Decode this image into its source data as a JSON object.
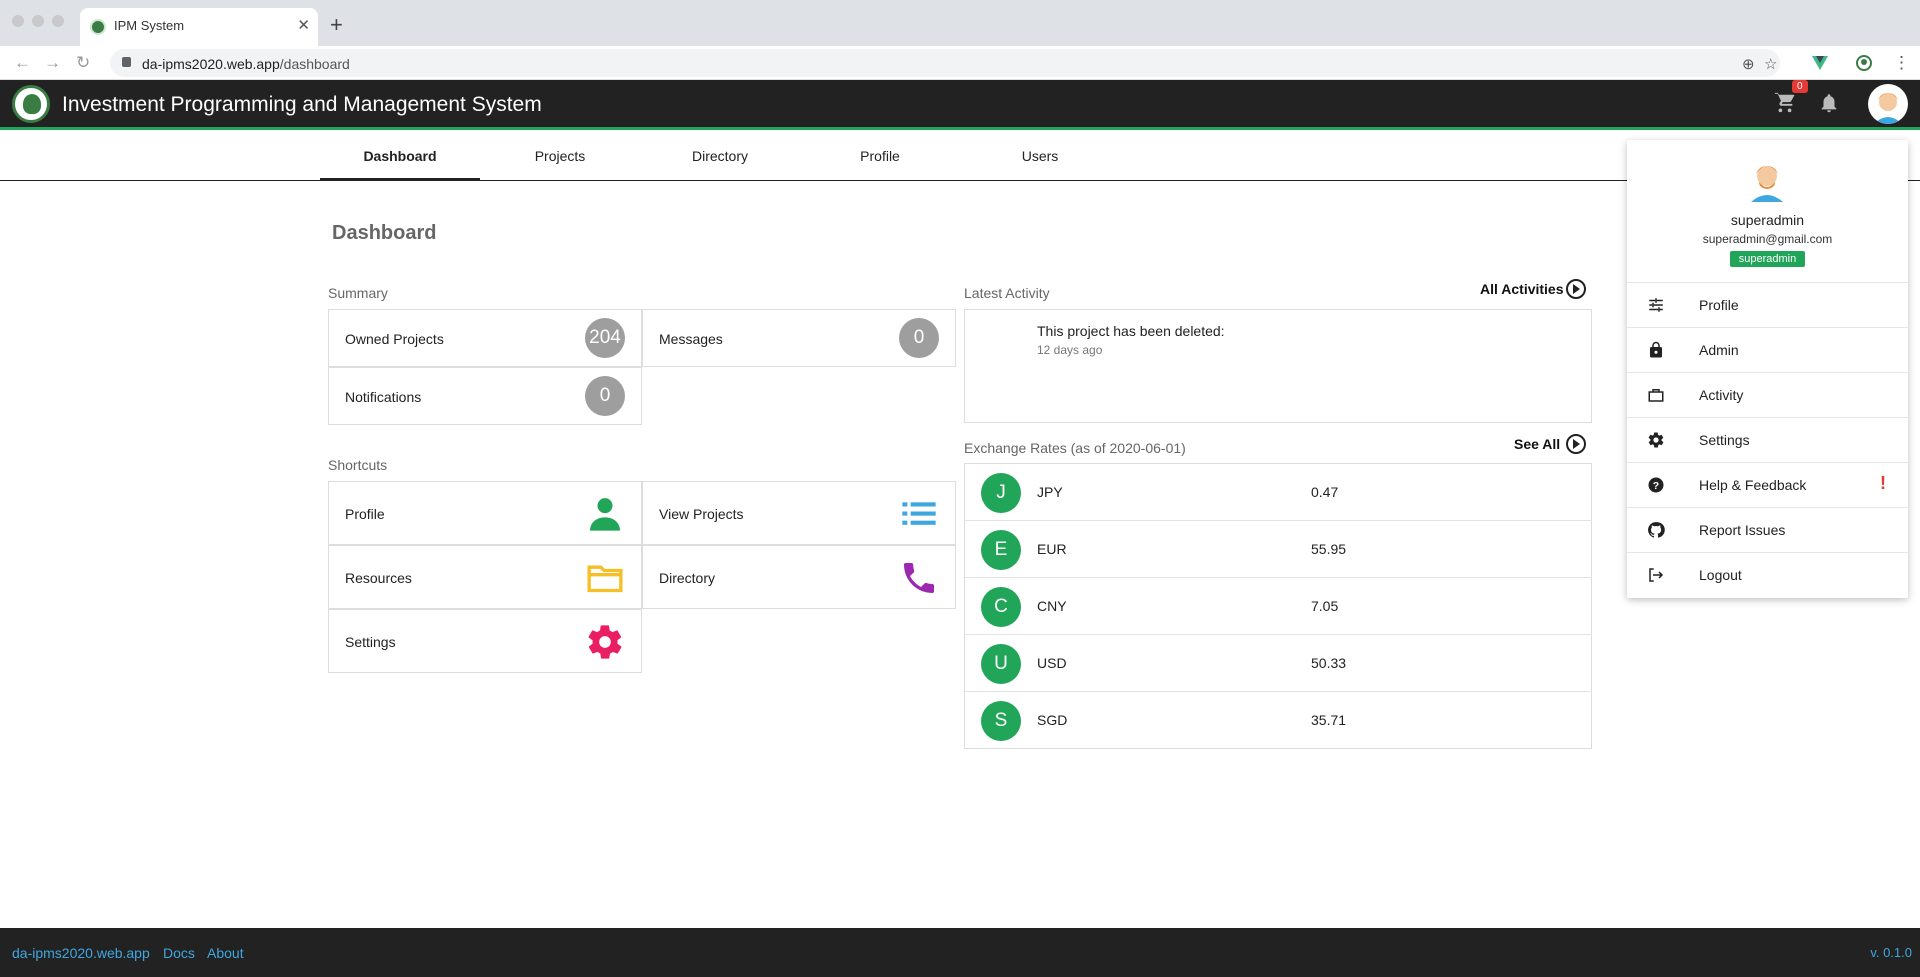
{
  "browser": {
    "tab_title": "IPM System",
    "url_host": "da-ipms2020.web.app",
    "url_path": "/dashboard"
  },
  "header": {
    "title": "Investment Programming and Management System",
    "cart_count": "0"
  },
  "nav": {
    "tabs": [
      "Dashboard",
      "Projects",
      "Directory",
      "Profile",
      "Users"
    ]
  },
  "dashboard": {
    "title": "Dashboard",
    "summary": {
      "label": "Summary",
      "owned_projects": {
        "label": "Owned Projects",
        "count": "204"
      },
      "messages": {
        "label": "Messages",
        "count": "0"
      },
      "notifications": {
        "label": "Notifications",
        "count": "0"
      }
    },
    "shortcuts": {
      "label": "Shortcuts",
      "profile": "Profile",
      "view_projects": "View Projects",
      "resources": "Resources",
      "directory": "Directory",
      "settings": "Settings"
    },
    "activity": {
      "label": "Latest Activity",
      "all_link": "All Activities",
      "message": "This project has been deleted:",
      "time": "12 days ago"
    },
    "rates": {
      "label": "Exchange Rates (as of 2020-06-01)",
      "see_all": "See All",
      "items": [
        {
          "initial": "J",
          "code": "JPY",
          "value": "0.47"
        },
        {
          "initial": "E",
          "code": "EUR",
          "value": "55.95"
        },
        {
          "initial": "C",
          "code": "CNY",
          "value": "7.05"
        },
        {
          "initial": "U",
          "code": "USD",
          "value": "50.33"
        },
        {
          "initial": "S",
          "code": "SGD",
          "value": "35.71"
        }
      ]
    }
  },
  "account_menu": {
    "username": "superadmin",
    "email": "superadmin@gmail.com",
    "role": "superadmin",
    "items": [
      "Profile",
      "Admin",
      "Activity",
      "Settings",
      "Help & Feedback",
      "Report Issues",
      "Logout"
    ],
    "help_alert": "!"
  },
  "footer": {
    "site": "da-ipms2020.web.app",
    "docs": "Docs",
    "about": "About",
    "version": "v. 0.1.0"
  },
  "colors": {
    "accent_green": "#21a558",
    "header_bg": "#222222",
    "link_blue": "#3fa7e0",
    "badge_red": "#e53935"
  }
}
